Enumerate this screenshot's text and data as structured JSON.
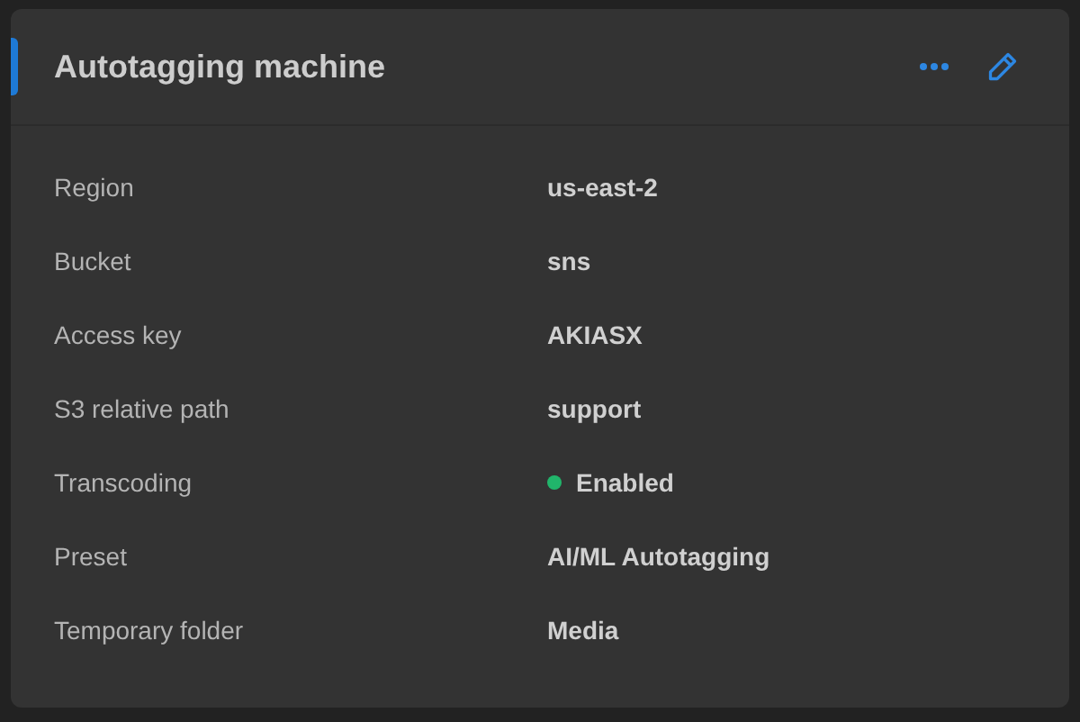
{
  "card": {
    "title": "Autotagging machine",
    "accent": true
  },
  "rows": [
    {
      "label": "Region",
      "value": "us-east-2"
    },
    {
      "label": "Bucket",
      "value": "sns"
    },
    {
      "label": "Access key",
      "value": "AKIASX"
    },
    {
      "label": "S3 relative path",
      "value": "support"
    },
    {
      "label": "Transcoding",
      "value": "Enabled",
      "kind": "status",
      "color": "#21b56b"
    },
    {
      "label": "Preset",
      "value": "AI/ML Autotagging"
    },
    {
      "label": "Temporary folder",
      "value": "Media"
    }
  ]
}
